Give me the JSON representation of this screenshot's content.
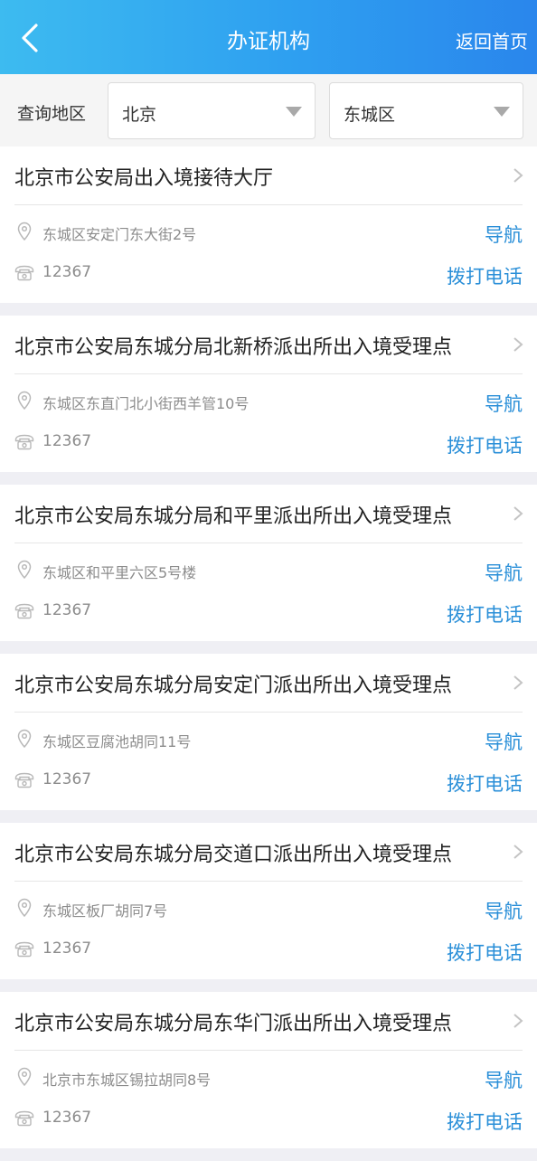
{
  "header": {
    "title": "办证机构",
    "home_label": "返回首页"
  },
  "filter": {
    "label": "查询地区",
    "city": "北京",
    "district": "东城区"
  },
  "colors": {
    "header_gradient_start": "#3dbbf0",
    "header_gradient_end": "#2a86ec",
    "link_blue": "#2a8fd8"
  },
  "icons": {
    "back": "back-chevron-icon",
    "dropdown": "caret-down-icon",
    "item_arrow": "chevron-right-icon",
    "location": "location-pin-icon",
    "phone": "telephone-icon"
  },
  "offices": [
    {
      "name": "北京市公安局出入境接待大厅",
      "address": "东城区安定门东大街2号",
      "phone": "12367",
      "nav_label": "导航",
      "call_label": "拨打电话"
    },
    {
      "name": "北京市公安局东城分局北新桥派出所出入境受理点",
      "address": "东城区东直门北小街西羊管10号",
      "phone": "12367",
      "nav_label": "导航",
      "call_label": "拨打电话"
    },
    {
      "name": "北京市公安局东城分局和平里派出所出入境受理点",
      "address": "东城区和平里六区5号楼",
      "phone": "12367",
      "nav_label": "导航",
      "call_label": "拨打电话"
    },
    {
      "name": "北京市公安局东城分局安定门派出所出入境受理点",
      "address": "东城区豆腐池胡同11号",
      "phone": "12367",
      "nav_label": "导航",
      "call_label": "拨打电话"
    },
    {
      "name": "北京市公安局东城分局交道口派出所出入境受理点",
      "address": "东城区板厂胡同7号",
      "phone": "12367",
      "nav_label": "导航",
      "call_label": "拨打电话"
    },
    {
      "name": "北京市公安局东城分局东华门派出所出入境受理点",
      "address": "北京市东城区锡拉胡同8号",
      "phone": "12367",
      "nav_label": "导航",
      "call_label": "拨打电话"
    }
  ]
}
